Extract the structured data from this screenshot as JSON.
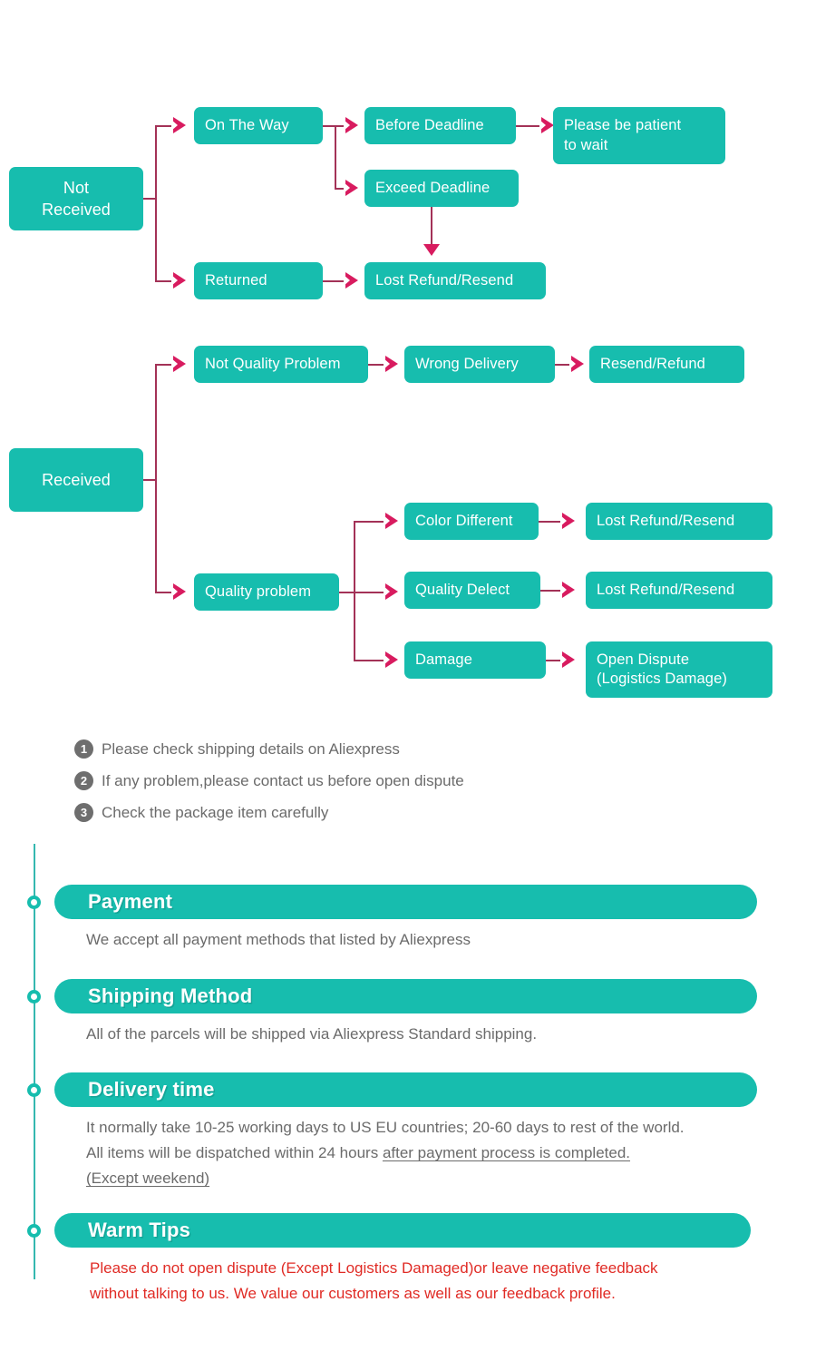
{
  "colors": {
    "teal": "#17bdae",
    "arrow": "#d81b5f",
    "connector": "#a33257",
    "note_badge": "#6e6e6e",
    "body_text": "#6b6b6b",
    "warn_text": "#e02b25",
    "timeline": "#35b8b0"
  },
  "flow_not_received": {
    "root": "Not\nReceived",
    "root_line1": "Not",
    "root_line2": "Received",
    "on_the_way": "On The Way",
    "before_deadline": "Before Deadline",
    "please_be_patient": "Please be patient\nto wait",
    "please_be_patient_line1": "Please be patient",
    "please_be_patient_line2": "to wait",
    "exceed_deadline": "Exceed Deadline",
    "returned": "Returned",
    "lost_refund_resend": "Lost Refund/Resend"
  },
  "flow_received": {
    "root": "Received",
    "not_quality_problem": "Not Quality Problem",
    "wrong_delivery": "Wrong Delivery",
    "resend_refund": "Resend/Refund",
    "quality_problem": "Quality problem",
    "color_different": "Color Different",
    "color_different_result": "Lost Refund/Resend",
    "quality_delect": "Quality Delect",
    "quality_delect_result": "Lost Refund/Resend",
    "damage": "Damage",
    "damage_result": "Open Dispute\n(Logistics Damage)",
    "damage_result_line1": "Open Dispute",
    "damage_result_line2": "(Logistics Damage)"
  },
  "notes": [
    {
      "num": "1",
      "text": "Please check shipping details on Aliexpress"
    },
    {
      "num": "2",
      "text": "If any problem,please contact us before open dispute"
    },
    {
      "num": "3",
      "text": "Check the package item carefully"
    }
  ],
  "panels": [
    {
      "title": "Payment",
      "body_line1": "We accept all payment methods that listed by Aliexpress"
    },
    {
      "title": "Shipping Method",
      "body_line1": "All of the parcels will be shipped via Aliexpress Standard shipping."
    },
    {
      "title": "Delivery time",
      "body_line1": "It normally take 10-25 working days to US EU countries; 20-60 days to rest of the world.",
      "body_line2_plain": "All items will be dispatched within 24 hours ",
      "body_line2_underline": "after payment process is completed.",
      "body_line3_underline": "(Except weekend)"
    },
    {
      "title": "Warm Tips",
      "body_line1": "Please do not open dispute (Except Logistics Damaged)or leave negative feedback",
      "body_line2": "without talking to us. We value our customers as well as our feedback profile."
    }
  ]
}
